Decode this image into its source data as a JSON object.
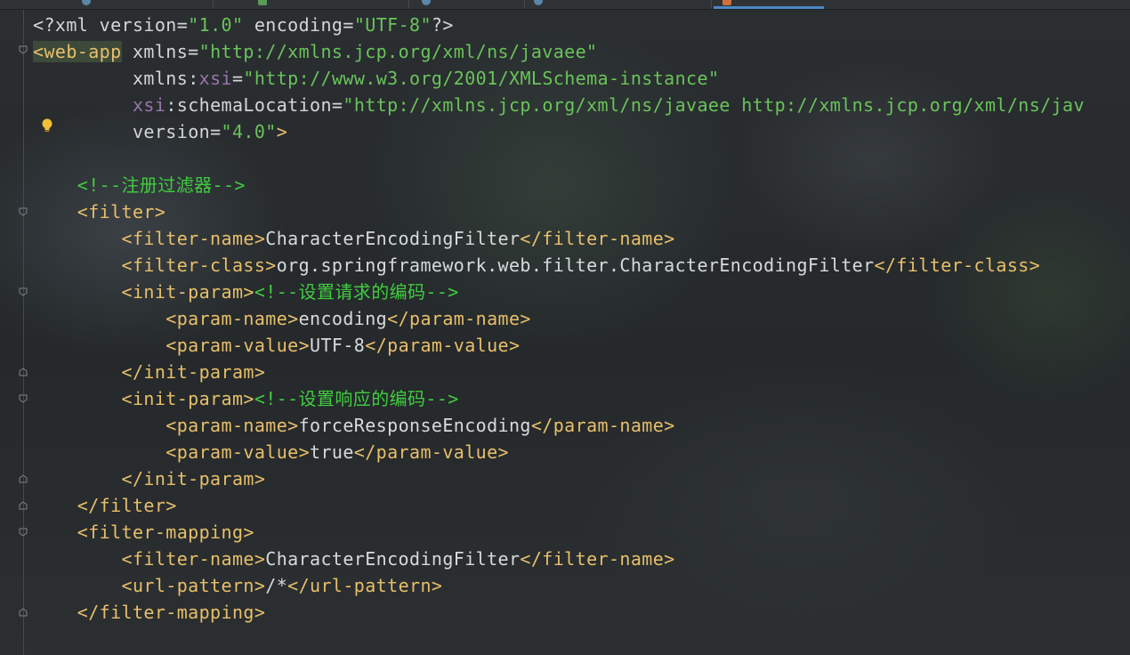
{
  "editor": {
    "language": "xml",
    "lines": [
      {
        "indent": 0,
        "parts": [
          {
            "cls": "t-decl",
            "text": "<?xml version="
          },
          {
            "cls": "t-str",
            "text": "\"1.0\""
          },
          {
            "cls": "t-decl",
            "text": " encoding="
          },
          {
            "cls": "t-str",
            "text": "\"UTF-8\""
          },
          {
            "cls": "t-decl",
            "text": "?>"
          }
        ]
      },
      {
        "indent": 0,
        "parts": [
          {
            "cls": "t-webapp",
            "text": "<web-app"
          },
          {
            "cls": "t-attr",
            "text": " xmlns="
          },
          {
            "cls": "t-str",
            "text": "\"http://xmlns.jcp.org/xml/ns/javaee\""
          }
        ]
      },
      {
        "indent": 9,
        "parts": [
          {
            "cls": "t-attr",
            "text": "xmlns:"
          },
          {
            "cls": "t-ns",
            "text": "xsi"
          },
          {
            "cls": "t-attr",
            "text": "="
          },
          {
            "cls": "t-str",
            "text": "\"http://www.w3.org/2001/XMLSchema-instance\""
          }
        ]
      },
      {
        "indent": 9,
        "parts": [
          {
            "cls": "t-ns",
            "text": "xsi"
          },
          {
            "cls": "t-attr",
            "text": ":schemaLocation="
          },
          {
            "cls": "t-str",
            "text": "\"http://xmlns.jcp.org/xml/ns/javaee http://xmlns.jcp.org/xml/ns/jav"
          }
        ]
      },
      {
        "indent": 9,
        "parts": [
          {
            "cls": "t-attr",
            "text": "version="
          },
          {
            "cls": "t-str",
            "text": "\"4.0\""
          },
          {
            "cls": "t-tag",
            "text": ">"
          }
        ]
      },
      {
        "indent": 0,
        "parts": []
      },
      {
        "indent": 4,
        "parts": [
          {
            "cls": "t-cmt",
            "text": "<!--注册过滤器-->"
          }
        ]
      },
      {
        "indent": 4,
        "parts": [
          {
            "cls": "t-tag",
            "text": "<filter>"
          }
        ]
      },
      {
        "indent": 8,
        "parts": [
          {
            "cls": "t-tag",
            "text": "<filter-name>"
          },
          {
            "cls": "t-txt",
            "text": "CharacterEncodingFilter"
          },
          {
            "cls": "t-tag",
            "text": "</filter-name>"
          }
        ]
      },
      {
        "indent": 8,
        "parts": [
          {
            "cls": "t-tag",
            "text": "<filter-class>"
          },
          {
            "cls": "t-txt",
            "text": "org.springframework.web.filter.CharacterEncodingFilter"
          },
          {
            "cls": "t-tag",
            "text": "</filter-class>"
          }
        ]
      },
      {
        "indent": 8,
        "parts": [
          {
            "cls": "t-tag",
            "text": "<init-param>"
          },
          {
            "cls": "t-cmt",
            "text": "<!--设置请求的编码-->"
          }
        ]
      },
      {
        "indent": 12,
        "parts": [
          {
            "cls": "t-tag",
            "text": "<param-name>"
          },
          {
            "cls": "t-txt",
            "text": "encoding"
          },
          {
            "cls": "t-tag",
            "text": "</param-name>"
          }
        ]
      },
      {
        "indent": 12,
        "parts": [
          {
            "cls": "t-tag",
            "text": "<param-value>"
          },
          {
            "cls": "t-txt",
            "text": "UTF-8"
          },
          {
            "cls": "t-tag",
            "text": "</param-value>"
          }
        ]
      },
      {
        "indent": 8,
        "parts": [
          {
            "cls": "t-tag",
            "text": "</init-param>"
          }
        ]
      },
      {
        "indent": 8,
        "parts": [
          {
            "cls": "t-tag",
            "text": "<init-param>"
          },
          {
            "cls": "t-cmt",
            "text": "<!--设置响应的编码-->"
          }
        ]
      },
      {
        "indent": 12,
        "parts": [
          {
            "cls": "t-tag",
            "text": "<param-name>"
          },
          {
            "cls": "t-txt",
            "text": "forceResponseEncoding"
          },
          {
            "cls": "t-tag",
            "text": "</param-name>"
          }
        ]
      },
      {
        "indent": 12,
        "parts": [
          {
            "cls": "t-tag",
            "text": "<param-value>"
          },
          {
            "cls": "t-txt",
            "text": "true"
          },
          {
            "cls": "t-tag",
            "text": "</param-value>"
          }
        ]
      },
      {
        "indent": 8,
        "parts": [
          {
            "cls": "t-tag",
            "text": "</init-param>"
          }
        ]
      },
      {
        "indent": 4,
        "parts": [
          {
            "cls": "t-tag",
            "text": "</filter>"
          }
        ]
      },
      {
        "indent": 4,
        "parts": [
          {
            "cls": "t-tag",
            "text": "<filter-mapping>"
          }
        ]
      },
      {
        "indent": 8,
        "parts": [
          {
            "cls": "t-tag",
            "text": "<filter-name>"
          },
          {
            "cls": "t-txt",
            "text": "CharacterEncodingFilter"
          },
          {
            "cls": "t-tag",
            "text": "</filter-name>"
          }
        ]
      },
      {
        "indent": 8,
        "parts": [
          {
            "cls": "t-tag",
            "text": "<url-pattern>"
          },
          {
            "cls": "t-txt",
            "text": "/*"
          },
          {
            "cls": "t-tag",
            "text": "</url-pattern>"
          }
        ]
      },
      {
        "indent": 4,
        "parts": [
          {
            "cls": "t-tag",
            "text": "</filter-mapping>"
          }
        ]
      }
    ]
  },
  "colors": {
    "tag": "#e8bf6a",
    "string": "#6ac35a",
    "comment": "#3fcc3f",
    "namespace": "#9876aa",
    "text": "#d7dadc"
  },
  "gutter": {
    "icons": [
      "fold-marker-icon",
      "intention-bulb-icon"
    ]
  }
}
